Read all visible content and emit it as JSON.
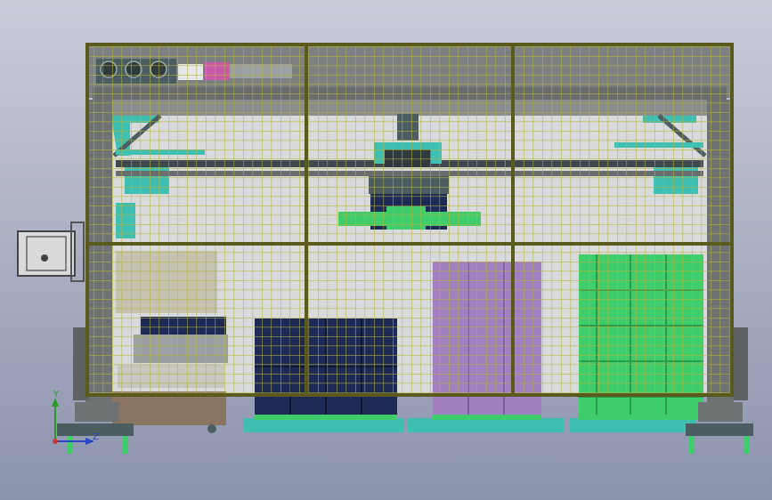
{
  "viewport": {
    "background_top": "#c9ccd9",
    "background_bottom": "#8c93ad"
  },
  "colors": {
    "fence": "#b7b33a",
    "fence_dark": "#5a5a1e",
    "frame_gray": "#6f7272",
    "panel_light": "#d9dadc",
    "teal": "#3fbfb2",
    "green": "#3fcc6a",
    "navy": "#1d2a55",
    "purple": "#a27fc0",
    "brown": "#8a7562",
    "pink": "#c85aa8"
  },
  "triad": {
    "y_label": "Y",
    "z_label": "Z",
    "y_color": "#2b9a2b",
    "z_color": "#2946c7",
    "x_color": "#c43a3a"
  }
}
